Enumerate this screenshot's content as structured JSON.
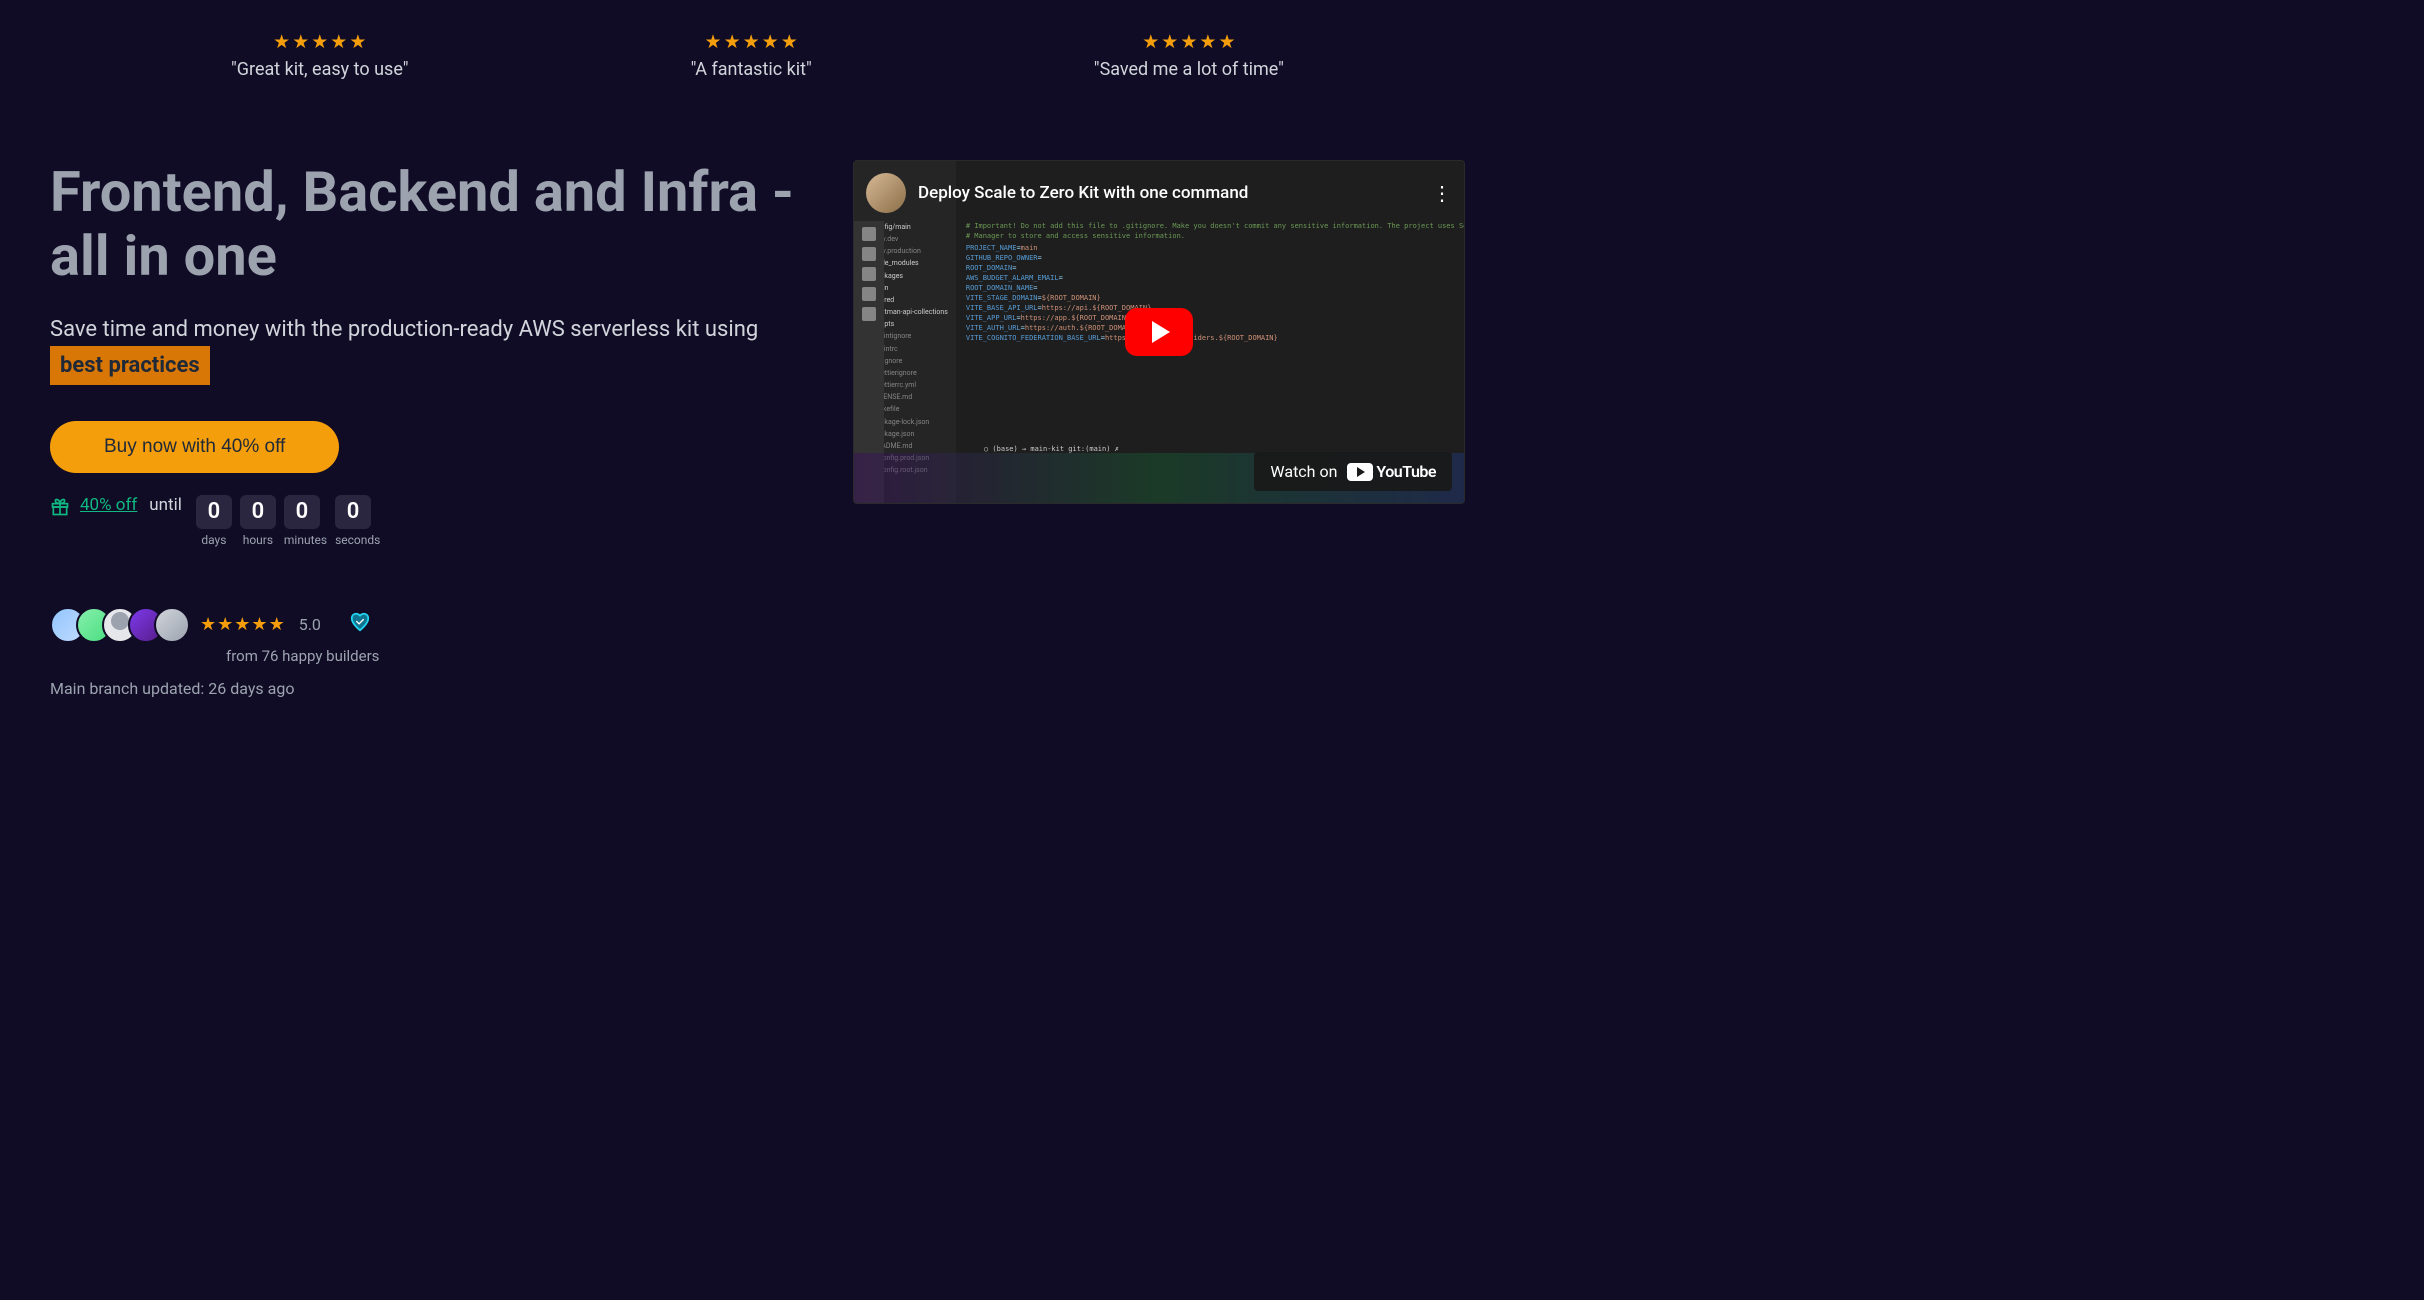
{
  "testimonials": [
    {
      "quote": "\"Great kit, easy to use\""
    },
    {
      "quote": "\"A fantastic kit\""
    },
    {
      "quote": "\"Saved me a lot of time\""
    }
  ],
  "hero": {
    "title": "Frontend, Backend and Infra - all in one",
    "subtitle_pre": "Save time and money with the production-ready AWS serverless kit using ",
    "subtitle_highlight": "best practices",
    "buy_label": "Buy now with 40% off",
    "promo_text": "40% off",
    "until": "until",
    "countdown": {
      "days": {
        "value": "0",
        "label": "days"
      },
      "hours": {
        "value": "0",
        "label": "hours"
      },
      "minutes": {
        "value": "0",
        "label": "minutes"
      },
      "seconds": {
        "value": "0",
        "label": "seconds"
      }
    }
  },
  "social": {
    "rating": "5.0",
    "builders": "from 76 happy builders",
    "updated": "Main branch updated: 26 days ago"
  },
  "video": {
    "title": "Deploy Scale to Zero Kit with one command",
    "watch_label": "Watch on",
    "youtube": "YouTube",
    "ide_tree": [
      {
        "ic": "y",
        "t": "config/main",
        "f": true
      },
      {
        "ic": "y",
        "t": ".env.dev"
      },
      {
        "ic": "y",
        "t": ".env.production"
      },
      {
        "ic": "b",
        "t": "node_modules",
        "f": true
      },
      {
        "ic": "o",
        "t": "packages",
        "f": true
      },
      {
        "ic": "o",
        "t": "main",
        "f": true
      },
      {
        "ic": "p",
        "t": "shared",
        "f": true
      },
      {
        "ic": "o",
        "t": "postman-api-collections",
        "f": true
      },
      {
        "ic": "b",
        "t": "scripts",
        "f": true
      },
      {
        "ic": "r",
        "t": ".eslintignore"
      },
      {
        "ic": "p",
        "t": ".eslintrc"
      },
      {
        "ic": "r",
        "t": ".gitignore"
      },
      {
        "ic": "o",
        "t": ".prettierignore"
      },
      {
        "ic": "y",
        "t": ".prettierrc.yml"
      },
      {
        "ic": "y",
        "t": "LICENSE.md"
      },
      {
        "ic": "o",
        "t": "Makefile"
      },
      {
        "ic": "g",
        "t": "package-lock.json"
      },
      {
        "ic": "g",
        "t": "package.json"
      },
      {
        "ic": "b",
        "t": "README.md"
      },
      {
        "ic": "b",
        "t": "tsconfig.prod.json"
      },
      {
        "ic": "b",
        "t": "tsconfig.root.json"
      }
    ],
    "ide_code": [
      "# Important! Do not add this file to .gitignore. Make you doesn't commit any sensitive information. The project uses Secrets",
      "# Manager to store and access sensitive information.",
      "",
      "PROJECT_NAME=main",
      "GITHUB_REPO_OWNER=<owner-or-organization-name>",
      "ROOT_DOMAIN=<root-domain-name>",
      "AWS_BUDGET_ALARM_EMAIL=<budget-email>",
      "ROOT_DOMAIN_NAME=<root-domain>",
      "VITE_STAGE_DOMAIN=${ROOT_DOMAIN}",
      "VITE_BASE_API_URL=https://api.${ROOT_DOMAIN}",
      "VITE_APP_URL=https://app.${ROOT_DOMAIN}",
      "VITE_AUTH_URL=https://auth.${ROOT_DOMAIN}",
      "VITE_COGNITO_FEDERATION_BASE_URL=https://external-providers.${ROOT_DOMAIN}"
    ],
    "ide_terminal": "○ (base) → main-kit git:(main) ✗ "
  }
}
